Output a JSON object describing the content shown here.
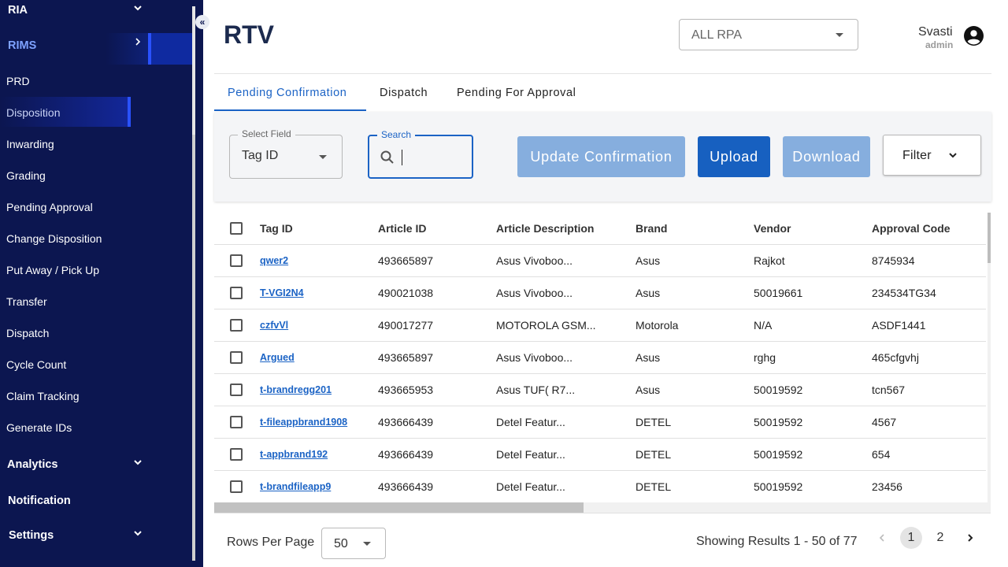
{
  "sidebar": {
    "items": [
      {
        "label": "RIA"
      },
      {
        "label": "RIMS"
      },
      {
        "label": "PRD"
      },
      {
        "label": "Disposition"
      },
      {
        "label": "Inwarding"
      },
      {
        "label": "Grading"
      },
      {
        "label": "Pending Approval"
      },
      {
        "label": "Change Disposition"
      },
      {
        "label": "Put Away / Pick Up"
      },
      {
        "label": "Transfer"
      },
      {
        "label": "Dispatch"
      },
      {
        "label": "Cycle Count"
      },
      {
        "label": "Claim Tracking"
      },
      {
        "label": "Generate IDs"
      },
      {
        "label": "Analytics"
      },
      {
        "label": "Notification"
      },
      {
        "label": "Settings"
      }
    ],
    "colors": {
      "background": "#0c1650",
      "active_bar": "#2a52ff",
      "active_text": "#7ea2ff"
    }
  },
  "header": {
    "title": "RTV",
    "rpa_select": {
      "value": "ALL RPA"
    },
    "user": {
      "name": "Svasti",
      "role": "admin"
    }
  },
  "tabs": [
    {
      "label": "Pending Confirmation",
      "active": true
    },
    {
      "label": "Dispatch",
      "active": false
    },
    {
      "label": "Pending For Approval",
      "active": false
    }
  ],
  "toolbar": {
    "select_field": {
      "legend": "Select Field",
      "value": "Tag ID"
    },
    "search": {
      "legend": "Search",
      "value": ""
    },
    "update_label": "Update Confirmation",
    "upload_label": "Upload",
    "download_label": "Download",
    "filter_label": "Filter"
  },
  "table": {
    "columns": [
      "Tag ID",
      "Article ID",
      "Article Description",
      "Brand",
      "Vendor",
      "Approval Code"
    ],
    "rows": [
      [
        "qwer2",
        "493665897",
        "Asus Vivoboo...",
        "Asus",
        "Rajkot",
        "8745934"
      ],
      [
        "T-VGI2N4",
        "490021038",
        "Asus Vivoboo...",
        "Asus",
        "50019661",
        "234534TG34"
      ],
      [
        "czfvVl",
        "490017277",
        "MOTOROLA GSM...",
        "Motorola",
        "N/A",
        "ASDF1441"
      ],
      [
        "Argued",
        "493665897",
        "Asus Vivoboo...",
        "Asus",
        "rghg",
        "465cfgvhj"
      ],
      [
        "t-brandregg201",
        "493665953",
        "Asus TUF( R7...",
        "Asus",
        "50019592",
        "tcn567"
      ],
      [
        "t-fileappbrand1908",
        "493666439",
        "Detel Featur...",
        "DETEL",
        "50019592",
        "4567"
      ],
      [
        "t-appbrand192",
        "493666439",
        "Detel Featur...",
        "DETEL",
        "50019592",
        "654"
      ],
      [
        "t-brandfileapp9",
        "493666439",
        "Detel Featur...",
        "DETEL",
        "50019592",
        "23456"
      ]
    ]
  },
  "pagination": {
    "rows_per_page_label": "Rows Per Page",
    "rows_per_page": "50",
    "results_text": "Showing Results 1 - 50 of 77",
    "pages": [
      "1",
      "2"
    ],
    "current_page": "1"
  },
  "icons": {
    "collapse": "double-chevron-left-icon",
    "user": "account-circle-icon",
    "search": "search-icon"
  },
  "colors": {
    "primary": "#1760c0",
    "disabled": "#86aede",
    "link": "#1b63c5"
  }
}
